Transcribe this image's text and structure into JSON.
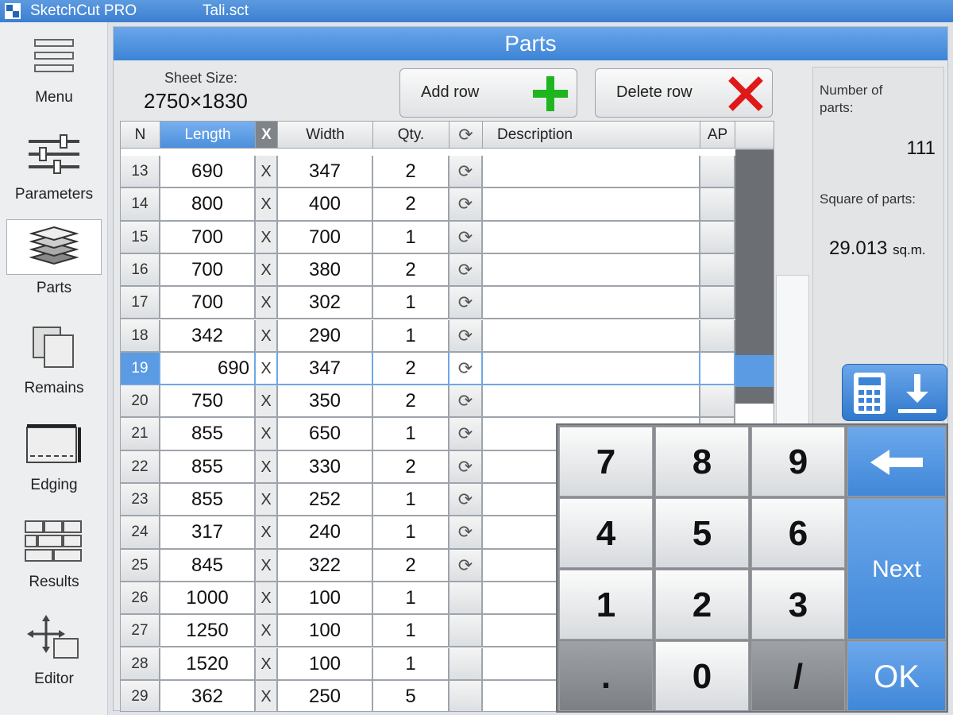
{
  "titlebar": {
    "app_name": "SketchCut PRO",
    "file_name": "Tali.sct"
  },
  "sidebar": {
    "items": [
      {
        "label": "Menu",
        "icon": "menu-icon"
      },
      {
        "label": "Parameters",
        "icon": "sliders-icon"
      },
      {
        "label": "Parts",
        "icon": "layers-icon",
        "active": true
      },
      {
        "label": "Remains",
        "icon": "remains-icon"
      },
      {
        "label": "Edging",
        "icon": "edging-icon"
      },
      {
        "label": "Results",
        "icon": "results-icon"
      },
      {
        "label": "Editor",
        "icon": "move-icon"
      }
    ]
  },
  "main": {
    "title": "Parts",
    "sheet_size_label": "Sheet Size:",
    "sheet_size_value": "2750×1830",
    "add_row_label": "Add row",
    "delete_row_label": "Delete row"
  },
  "table": {
    "headers": {
      "n": "N",
      "length": "Length",
      "x": "X",
      "width": "Width",
      "qty": "Qty.",
      "description": "Description",
      "ap": "AP"
    },
    "rows": [
      {
        "n": "13",
        "length": "690",
        "x": "X",
        "width": "347",
        "qty": "2",
        "rotate": true
      },
      {
        "n": "14",
        "length": "800",
        "x": "X",
        "width": "400",
        "qty": "2",
        "rotate": true
      },
      {
        "n": "15",
        "length": "700",
        "x": "X",
        "width": "700",
        "qty": "1",
        "rotate": true
      },
      {
        "n": "16",
        "length": "700",
        "x": "X",
        "width": "380",
        "qty": "2",
        "rotate": true
      },
      {
        "n": "17",
        "length": "700",
        "x": "X",
        "width": "302",
        "qty": "1",
        "rotate": true
      },
      {
        "n": "18",
        "length": "342",
        "x": "X",
        "width": "290",
        "qty": "1",
        "rotate": true
      },
      {
        "n": "19",
        "length": "690",
        "x": "X",
        "width": "347",
        "qty": "2",
        "rotate": true,
        "selected": true
      },
      {
        "n": "20",
        "length": "750",
        "x": "X",
        "width": "350",
        "qty": "2",
        "rotate": true
      },
      {
        "n": "21",
        "length": "855",
        "x": "X",
        "width": "650",
        "qty": "1",
        "rotate": true
      },
      {
        "n": "22",
        "length": "855",
        "x": "X",
        "width": "330",
        "qty": "2",
        "rotate": true
      },
      {
        "n": "23",
        "length": "855",
        "x": "X",
        "width": "252",
        "qty": "1",
        "rotate": true
      },
      {
        "n": "24",
        "length": "317",
        "x": "X",
        "width": "240",
        "qty": "1",
        "rotate": true
      },
      {
        "n": "25",
        "length": "845",
        "x": "X",
        "width": "322",
        "qty": "2",
        "rotate": true
      },
      {
        "n": "26",
        "length": "1000",
        "x": "X",
        "width": "100",
        "qty": "1",
        "rotate": false
      },
      {
        "n": "27",
        "length": "1250",
        "x": "X",
        "width": "100",
        "qty": "1",
        "rotate": false
      },
      {
        "n": "28",
        "length": "1520",
        "x": "X",
        "width": "100",
        "qty": "1",
        "rotate": false
      },
      {
        "n": "29",
        "length": "362",
        "x": "X",
        "width": "250",
        "qty": "5",
        "rotate": false
      }
    ]
  },
  "stats": {
    "number_label": "Number of parts:",
    "number_value": "111",
    "square_label": "Square of parts:",
    "square_value": "29.013",
    "square_unit": "sq.m."
  },
  "keypad": {
    "keys": [
      "7",
      "8",
      "9",
      "4",
      "5",
      "6",
      "1",
      "2",
      "3",
      ".",
      "0",
      "/"
    ],
    "next_label": "Next",
    "ok_label": "OK"
  },
  "colors": {
    "accent": "#3c84d6",
    "selected_row": "#5a9be4"
  }
}
